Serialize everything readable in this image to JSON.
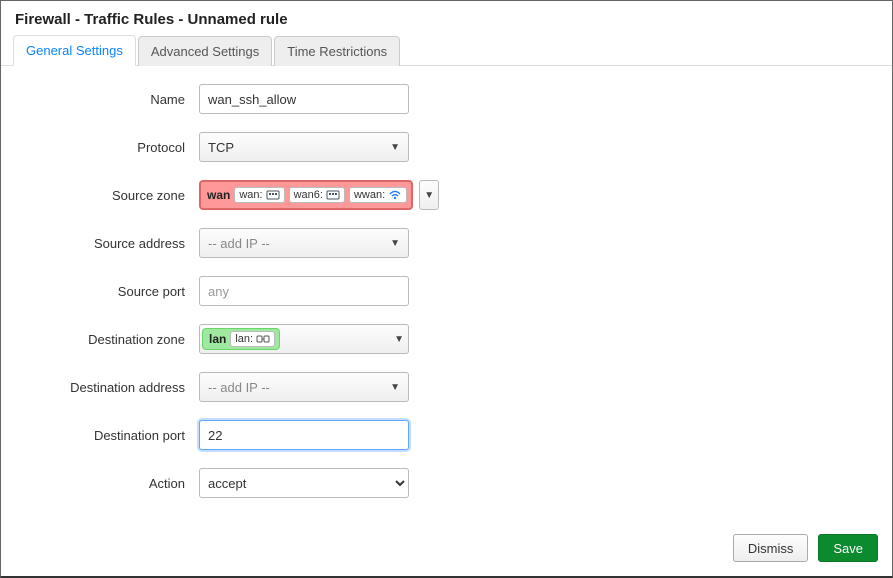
{
  "title": "Firewall - Traffic Rules - Unnamed rule",
  "tabs": {
    "general": "General Settings",
    "advanced": "Advanced Settings",
    "time": "Time Restrictions"
  },
  "labels": {
    "name": "Name",
    "protocol": "Protocol",
    "src_zone": "Source zone",
    "src_addr": "Source address",
    "src_port": "Source port",
    "dst_zone": "Destination zone",
    "dst_addr": "Destination address",
    "dst_port": "Destination port",
    "action": "Action"
  },
  "values": {
    "name": "wan_ssh_allow",
    "protocol": "TCP",
    "src_addr_placeholder": "-- add IP --",
    "src_port_placeholder": "any",
    "dst_addr_placeholder": "-- add IP --",
    "dst_port": "22",
    "action": "accept"
  },
  "src_zone": {
    "name": "wan",
    "ifaces": [
      {
        "label": "wan:",
        "icon": "ethernet"
      },
      {
        "label": "wan6:",
        "icon": "ethernet"
      },
      {
        "label": "wwan:",
        "icon": "wifi"
      }
    ]
  },
  "dst_zone": {
    "name": "lan",
    "ifaces": [
      {
        "label": "lan:",
        "icon": "bridge"
      }
    ]
  },
  "buttons": {
    "dismiss": "Dismiss",
    "save": "Save"
  }
}
